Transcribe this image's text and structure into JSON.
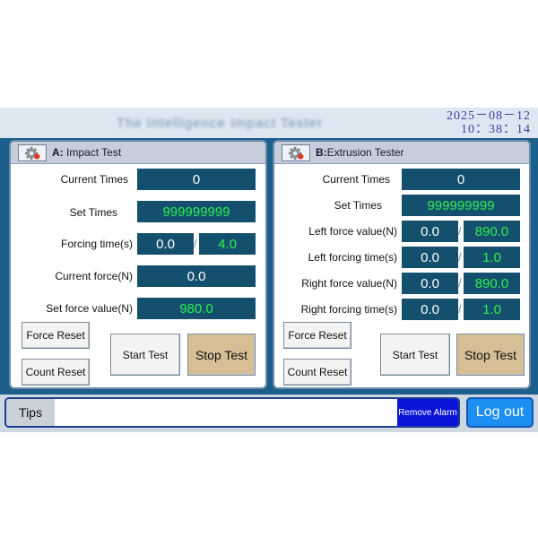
{
  "header": {
    "title": "The Intelligence Impact Tester",
    "date": "2025－08－12",
    "time": "10：38：14"
  },
  "panel_a": {
    "letter": "A:",
    "title": "Impact Test",
    "current_times_label": "Current  Times",
    "current_times_value": "0",
    "set_times_label": "Set Times",
    "set_times_value": "999999999",
    "forcing_time_label": "Forcing time(s)",
    "forcing_time_current": "0.0",
    "forcing_time_set": "4.0",
    "current_force_label": "Current force(N)",
    "current_force_value": "0.0",
    "set_force_label": "Set force value(N)",
    "set_force_value": "980.0",
    "force_reset": "Force Reset",
    "count_reset": "Count Reset",
    "start_test": "Start Test",
    "stop_test": "Stop Test"
  },
  "panel_b": {
    "letter": "B:",
    "title": "Extrusion Tester",
    "current_times_label": "Current  Times",
    "current_times_value": "0",
    "set_times_label": "Set Times",
    "set_times_value": "999999999",
    "left_force_label": "Left force value(N)",
    "left_force_current": "0.0",
    "left_force_set": "890.0",
    "left_time_label": "Left  forcing time(s)",
    "left_time_current": "0.0",
    "left_time_set": "1.0",
    "right_force_label": "Right force value(N)",
    "right_force_current": "0.0",
    "right_force_set": "890.0",
    "right_time_label": "Right forcing time(s)",
    "right_time_current": "0.0",
    "right_time_set": "1.0",
    "force_reset": "Force Reset",
    "count_reset": "Count Reset",
    "start_test": "Start Test",
    "stop_test": "Stop Test"
  },
  "footer": {
    "tips_label": "Tips",
    "tips_message": "",
    "remove_alarm": "Remove Alarm",
    "logout": "Log out"
  },
  "colors": {
    "background": "#1d5f8c",
    "value_box": "#14506e",
    "value_green": "#2cf04a",
    "stop_button": "#d6bf95",
    "remove_alarm": "#0a14d8",
    "logout": "#1d8ff2"
  },
  "icons": [
    "settings-gear-icon"
  ],
  "separator": "/"
}
